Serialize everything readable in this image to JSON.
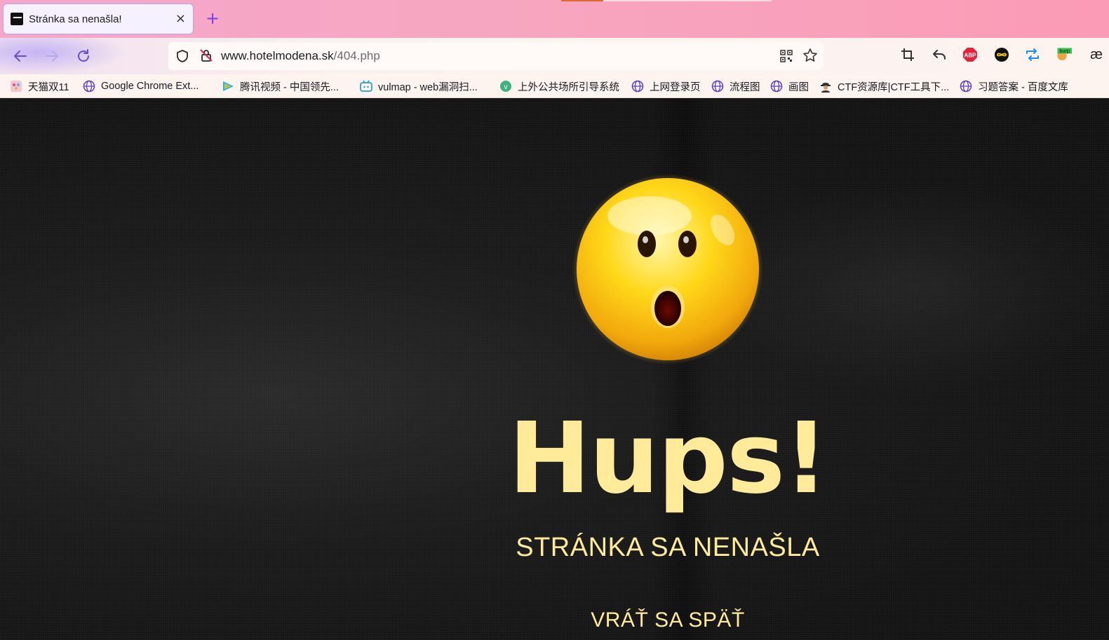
{
  "browser": {
    "tab": {
      "title": "Stránka sa nenašla!",
      "close_symbol": "×"
    },
    "new_tab_symbol": "+",
    "url": {
      "host": "www.hotelmodena.sk",
      "path": "/404.php"
    },
    "extensions": [
      "crop-icon",
      "undo-icon",
      "adblock-plus-icon",
      "infinity-icon",
      "sync-icon",
      "burp-icon",
      "ae-icon"
    ],
    "extension_labels": {
      "abp": "ABP",
      "burp": "burp",
      "ae": "æ"
    },
    "bookmarks": [
      {
        "label": "天猫双11",
        "icon": "tmall-icon"
      },
      {
        "label": "Google Chrome Ext...",
        "icon": "globe-icon"
      },
      {
        "label": "腾讯视频 - 中国领先...",
        "icon": "tencent-video-icon"
      },
      {
        "label": "vulmap - web漏洞扫...",
        "icon": "bilibili-icon"
      },
      {
        "label": "上外公共场所引导系统",
        "icon": "vue-icon"
      },
      {
        "label": "上网登录页",
        "icon": "globe-icon"
      },
      {
        "label": "流程图",
        "icon": "globe-icon"
      },
      {
        "label": "画图",
        "icon": "globe-icon"
      },
      {
        "label": "CTF资源库|CTF工具下...",
        "icon": "hacker-icon"
      },
      {
        "label": "习题答案 - 百度文库",
        "icon": "globe-icon"
      }
    ],
    "accent_color": "#6c4cd7"
  },
  "page": {
    "headline": "Hups!",
    "subtitle": "STRÁNKA SA NENAŠLA",
    "back_link": "VRÁŤ SA SPÄŤ",
    "text_color": "#ffeb9a",
    "background_color": "#161616",
    "emoji": "surprised-face-icon"
  }
}
